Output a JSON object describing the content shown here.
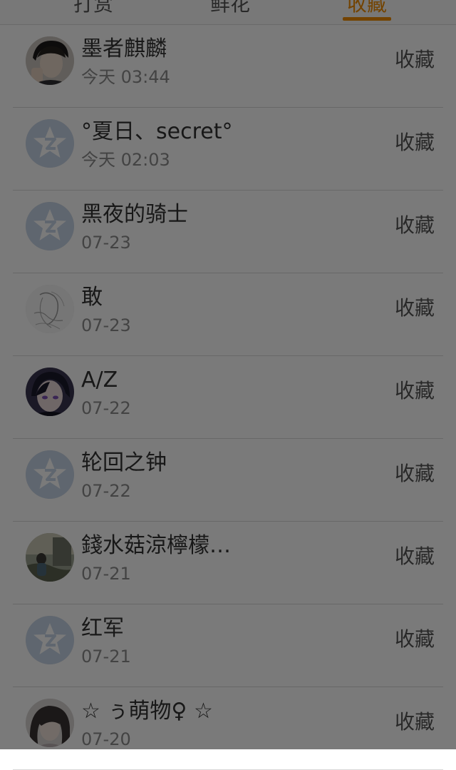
{
  "tabs": [
    {
      "label": "打赏"
    },
    {
      "label": "鲜花"
    },
    {
      "label": "收藏"
    }
  ],
  "active_tab_color": "#f08c00",
  "items": [
    {
      "name": "墨者麒麟",
      "time": "今天 03:44",
      "action": "收藏",
      "avatar": "photo-boy"
    },
    {
      "name": "°夏日、secret°",
      "time": "今天 02:03",
      "action": "收藏",
      "avatar": "default-qzone-star"
    },
    {
      "name": "黑夜的骑士",
      "time": "07-23",
      "action": "收藏",
      "avatar": "default-qzone-star"
    },
    {
      "name": "敢",
      "time": "07-23",
      "action": "收藏",
      "avatar": "sketch-drawing"
    },
    {
      "name": "A/Z",
      "time": "07-22",
      "action": "收藏",
      "avatar": "anime-character"
    },
    {
      "name": "轮回之钟",
      "time": "07-22",
      "action": "收藏",
      "avatar": "default-qzone-star"
    },
    {
      "name": "錢水菇涼檸檬…",
      "time": "07-21",
      "action": "收藏",
      "avatar": "photo-outdoor"
    },
    {
      "name": "红军",
      "time": "07-21",
      "action": "收藏",
      "avatar": "default-qzone-star"
    },
    {
      "name": "☆ ぅ萌物♀ ☆",
      "time": "07-20",
      "action": "收藏",
      "avatar": "photo-girl"
    }
  ]
}
